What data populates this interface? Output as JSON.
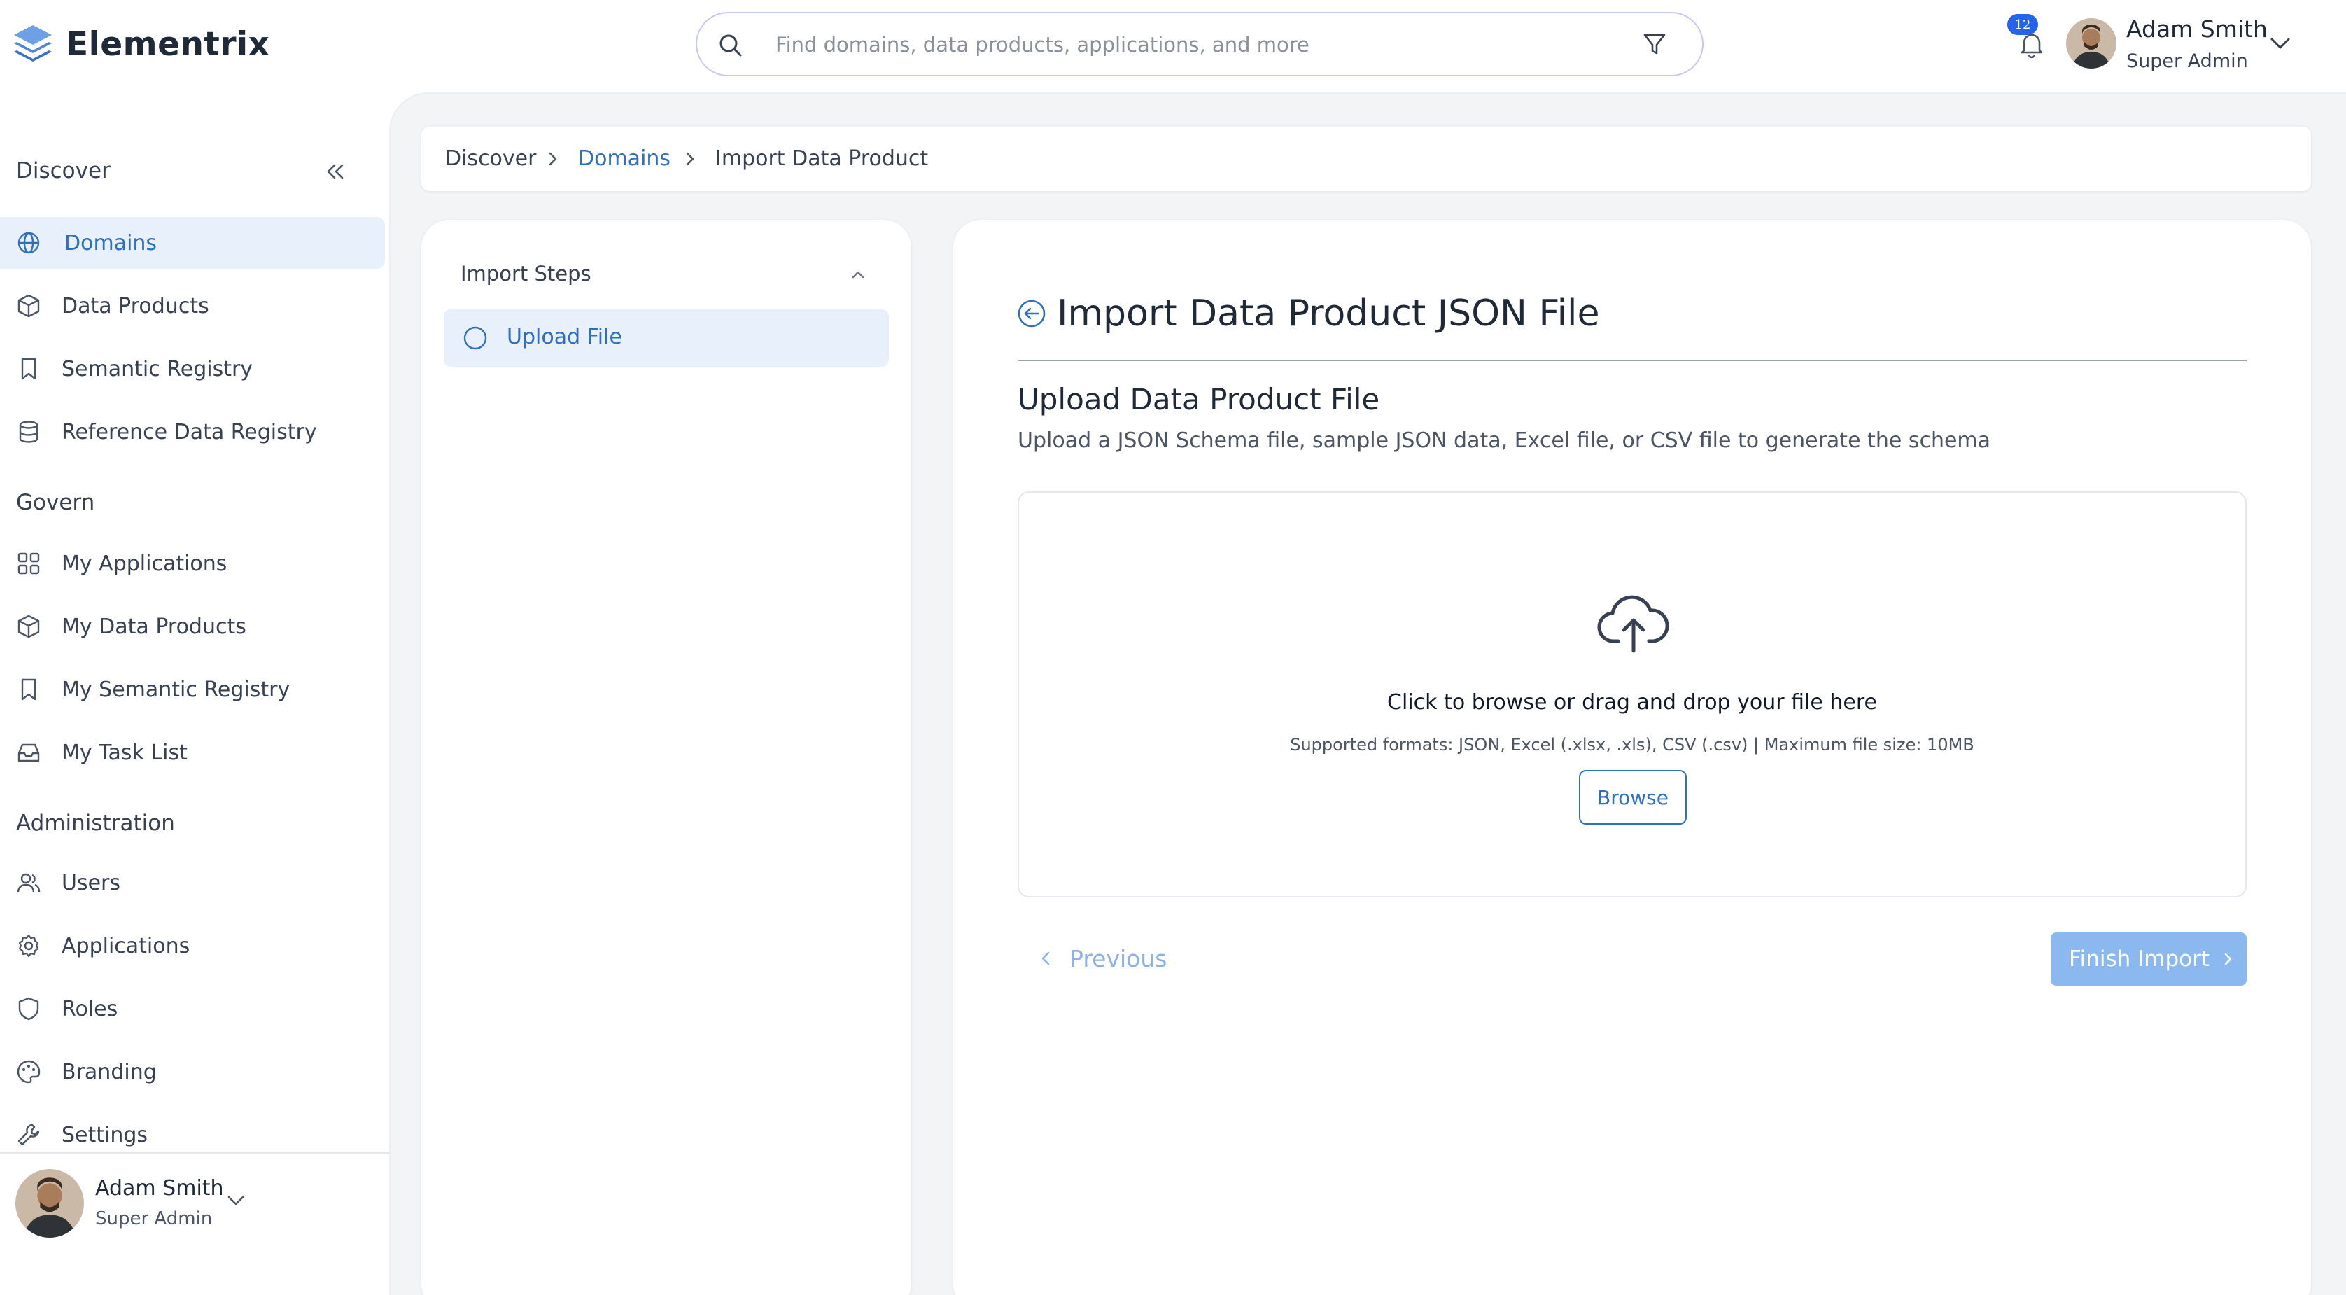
{
  "app": {
    "name": "Elementrix"
  },
  "search": {
    "placeholder": "Find domains, data products, applications, and more"
  },
  "notifications": {
    "count": "12"
  },
  "user": {
    "name": "Adam Smith",
    "role": "Super Admin"
  },
  "sidebar": {
    "sections": [
      {
        "label": "Discover",
        "items": [
          {
            "label": "Domains",
            "icon": "globe-icon",
            "active": true
          },
          {
            "label": "Data Products",
            "icon": "box-icon"
          },
          {
            "label": "Semantic Registry",
            "icon": "bookmark-icon"
          },
          {
            "label": "Reference Data Registry",
            "icon": "database-icon"
          }
        ]
      },
      {
        "label": "Govern",
        "items": [
          {
            "label": "My Applications",
            "icon": "grid-icon"
          },
          {
            "label": "My Data Products",
            "icon": "box-icon"
          },
          {
            "label": "My Semantic Registry",
            "icon": "bookmark-icon"
          },
          {
            "label": "My Task List",
            "icon": "inbox-icon"
          }
        ]
      },
      {
        "label": "Administration",
        "items": [
          {
            "label": "Users",
            "icon": "users-icon"
          },
          {
            "label": "Applications",
            "icon": "gear-icon"
          },
          {
            "label": "Roles",
            "icon": "shield-icon"
          },
          {
            "label": "Branding",
            "icon": "palette-icon"
          },
          {
            "label": "Settings",
            "icon": "wrench-icon"
          }
        ]
      }
    ]
  },
  "breadcrumb": [
    "Discover",
    "Domains",
    "Import Data Product"
  ],
  "steps": {
    "title": "Import Steps",
    "items": [
      {
        "label": "Upload File",
        "active": true
      }
    ]
  },
  "content": {
    "title": "Import Data Product JSON File",
    "section_title": "Upload Data Product File",
    "section_desc": "Upload a JSON Schema file, sample JSON data, Excel file, or CSV file to generate the schema",
    "dropzone": {
      "main": "Click to browse or drag and drop your file here",
      "sub": "Supported formats: JSON, Excel (.xlsx, .xls), CSV (.csv) | Maximum file size: 10MB",
      "browse_label": "Browse"
    },
    "previous_label": "Previous",
    "finish_label": "Finish Import"
  },
  "colors": {
    "accent": "#2f6fbf",
    "active_bg": "#e8f1fb",
    "finish_bg": "#8ab8ef",
    "badge": "#2563eb"
  }
}
